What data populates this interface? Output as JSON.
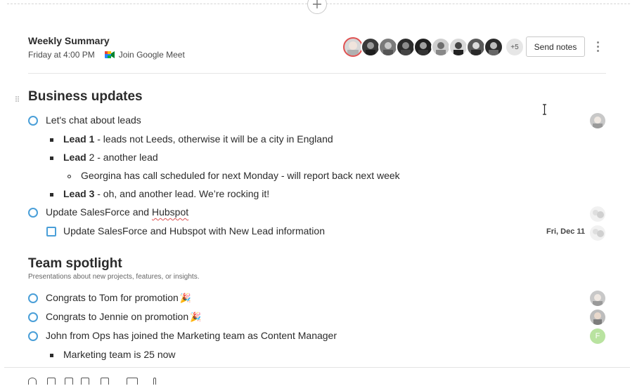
{
  "meeting": {
    "title": "Weekly Summary",
    "time": "Friday at 4:00 PM",
    "meet_link": "Join Google Meet",
    "attendees_more": "+5",
    "send_notes": "Send notes"
  },
  "sections": {
    "business": {
      "title": "Business updates",
      "items": {
        "leads": "Let's chat about leads",
        "lead1_bold": "Lead 1",
        "lead1_rest": " - leads not Leeds, otherwise it will be a city in England",
        "lead2_bold": "Lead",
        "lead2_rest": " 2 - another lead",
        "georgina": "Georgina has call scheduled for next Monday - will report back next week",
        "lead3_bold": "Lead 3",
        "lead3_rest": " - oh, and another lead. We’re rocking it!",
        "salesforce_pre": "Update SalesForce and ",
        "salesforce_spell": "Hubspot",
        "salesforce_task": "Update SalesForce and Hubspot with New Lead information",
        "due_date": "Fri, Dec 11"
      }
    },
    "team": {
      "title": "Team spotlight",
      "subtitle": "Presentations about new projects, features, or insights.",
      "items": {
        "tom": "Congrats to Tom for promotion",
        "jennie": "Congrats to Jennie on promotion",
        "party_emoji": "🎉",
        "john": "John from Ops has joined the Marketing team as Content Manager",
        "marketing": "Marketing team is 25 now"
      }
    }
  },
  "avatar_initial": "F",
  "colors": {
    "accent_blue": "#4a9fd8",
    "avatar_ring": "#e05252",
    "green_avatar": "#b9e3a0"
  }
}
